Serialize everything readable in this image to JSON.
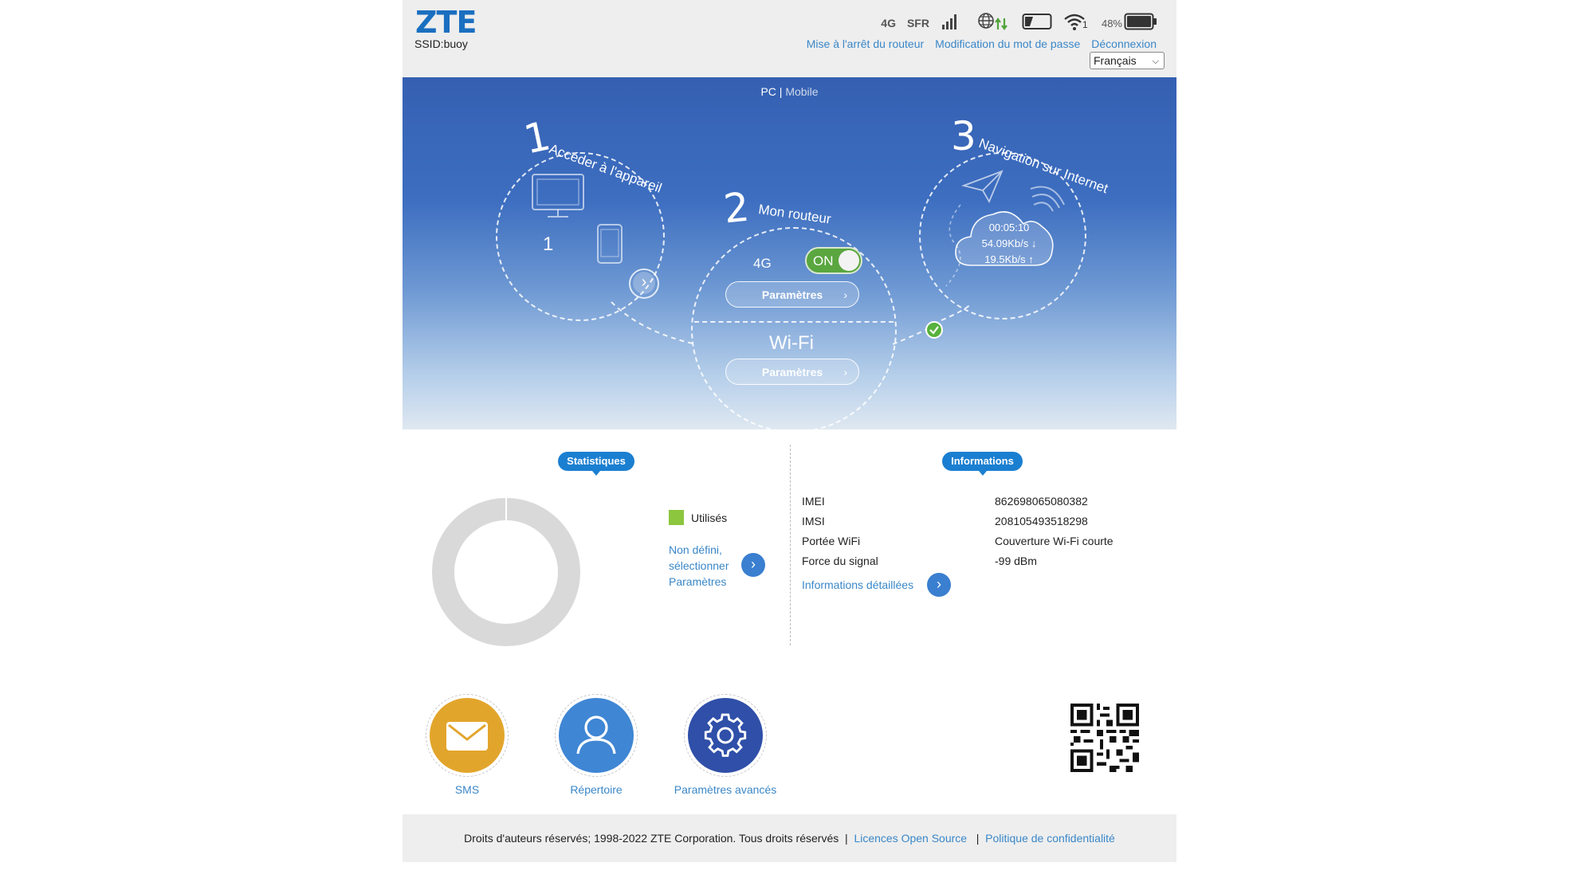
{
  "header": {
    "logo": "ZTE",
    "ssid": "SSID:buoy",
    "network_type": "4G",
    "operator": "SFR",
    "wifi_clients": "1",
    "battery_level": "48%",
    "links": {
      "shutdown": "Mise à l'arrêt du routeur",
      "change_password": "Modification du mot de passe",
      "logout": "Déconnexion"
    },
    "language": "Français"
  },
  "banner": {
    "view_pc": "PC",
    "view_separator": " | ",
    "view_mobile": "Mobile",
    "step1": {
      "number": "1",
      "title": "Accéder à l'appareil",
      "connected_devices": "1"
    },
    "step2": {
      "number": "2",
      "title": "Mon routeur",
      "mobile_label": "4G",
      "toggle_state": "ON",
      "mobile_settings": "Paramètres",
      "wifi_label": "Wi-Fi",
      "wifi_settings": "Paramètres"
    },
    "step3": {
      "number": "3",
      "title": "Navigation sur Internet",
      "duration": "00:05:10",
      "download": "54.09Kb/s ↓",
      "upload": "19.5Kb/s ↑"
    }
  },
  "stats": {
    "badge": "Statistiques",
    "legend_used": "Utilisés",
    "used_color": "#8cc63f",
    "undefined_line1": "Non défini,",
    "undefined_line2": "sélectionner",
    "undefined_line3": "Paramètres"
  },
  "info": {
    "badge": "Informations",
    "rows": [
      {
        "label": "IMEI",
        "value": "862698065080382"
      },
      {
        "label": "IMSI",
        "value": "208105493518298"
      },
      {
        "label": "Portée WiFi",
        "value": "Couverture Wi-Fi courte"
      },
      {
        "label": "Force du signal",
        "value": "-99 dBm"
      }
    ],
    "details_link": "Informations détaillées"
  },
  "apps": [
    {
      "label": "SMS",
      "color": "#e2a52c",
      "icon": "envelope-icon"
    },
    {
      "label": "Répertoire",
      "color": "#3f86d4",
      "icon": "person-icon"
    },
    {
      "label": "Paramètres avancés",
      "color": "#2f4fa8",
      "icon": "gear-icon"
    }
  ],
  "footer": {
    "copyright": "Droits d'auteurs réservés; 1998-2022 ZTE Corporation. Tous droits réservés",
    "sep": "|",
    "open_source": "Licences Open Source",
    "privacy": "Politique de confidentialité"
  }
}
